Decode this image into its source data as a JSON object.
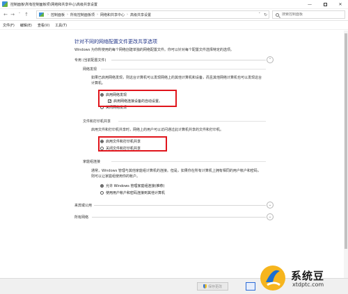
{
  "window": {
    "title": "控制面板\\所有控制面板项\\网络和共享中心\\高级共享设置",
    "minimize": "—",
    "close": "✕"
  },
  "address": {
    "back": "←",
    "forward": "→",
    "up": "↑",
    "crumbs": [
      "控制面板",
      "所有控制面板项",
      "网络和共享中心",
      "高级共享设置"
    ],
    "search_placeholder": "搜索控制面板"
  },
  "menu": [
    "文件(F)",
    "编辑(E)",
    "查看(V)",
    "工具(T)"
  ],
  "page": {
    "title": "针对不同的网络配置文件更改共享选项",
    "description": "Windows 为你所使用的每个网络创建单独的网络配置文件。你可以针对每个配置文件选择特定的选项。"
  },
  "sections": {
    "private": {
      "label": "专用 (当前配置文件)",
      "network_discovery": {
        "heading": "网络发现",
        "text": "如果已启用网络发现，则这台计算机可以发现网络上的其他计算机和设备，而且其他网络计算机也可以发现这台计算机。",
        "options": [
          "启用网络发现",
          "启用网络连接设备的自动设置。",
          "关闭网络发现"
        ]
      },
      "file_printer_sharing": {
        "heading": "文件和打印机共享",
        "text": "启用文件和打印机共享时，网络上的用户可以访问通过此计算机共享的文件和打印机。",
        "options": [
          "启用文件和打印机共享",
          "关闭文件和打印机共享"
        ]
      },
      "homegroup": {
        "heading": "家庭组连接",
        "text": "通常，Windows 管理与其他家庭组计算机的连接。但是，如果你在所有计算机上拥有相同的用户帐户和密码，则可以让家庭组使用你的帐户。",
        "options": [
          "允许 Windows 管理家庭组连接(推荐)",
          "使用用户帐户和密码连接到其他计算机"
        ]
      }
    },
    "guest": {
      "label": "来宾或公用"
    },
    "all": {
      "label": "所有网络"
    }
  },
  "footer": {
    "save_label": "保存更改"
  },
  "watermark": {
    "name": "系统豆",
    "url": "xtdptc.com"
  },
  "colors": {
    "title_blue": "#1e3287",
    "highlight_red": "#e0141b"
  }
}
